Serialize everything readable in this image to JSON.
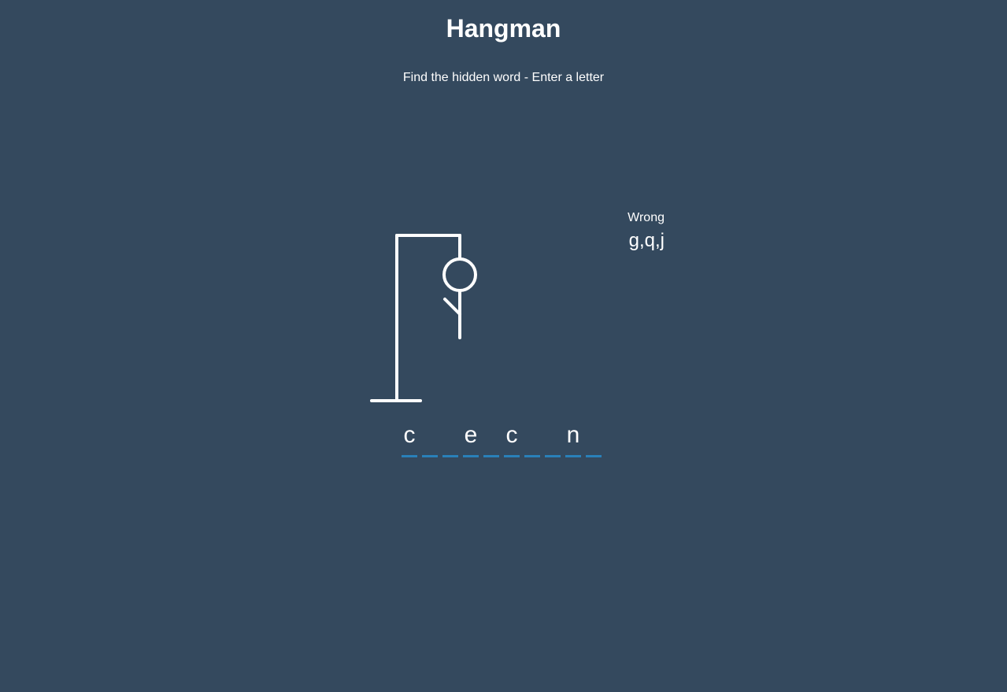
{
  "game": {
    "title": "Hangman",
    "instruction": "Find the hidden word - Enter a letter"
  },
  "wrong": {
    "label": "Wrong",
    "letters": "g,q,j",
    "count": 3
  },
  "word": {
    "slots": [
      "c",
      "",
      "",
      "e",
      "",
      "c",
      "",
      "",
      "n",
      ""
    ]
  },
  "colors": {
    "background": "#34495e",
    "text": "#ffffff",
    "underline": "#2980b9",
    "figure": "#ffffff"
  }
}
